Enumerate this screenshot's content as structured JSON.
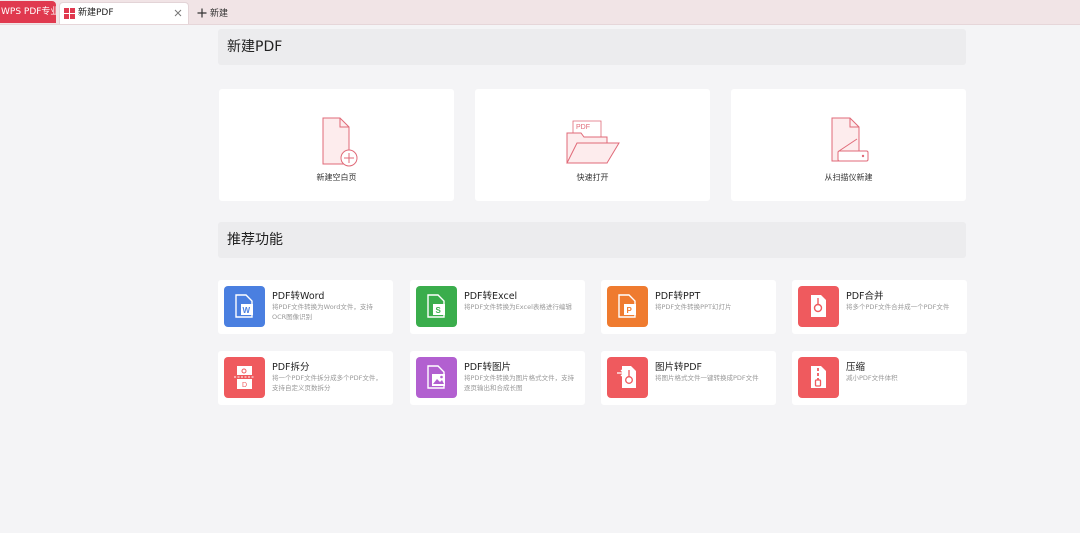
{
  "tabbar": {
    "brand_label": "WPS PDF专业版",
    "doc_tab_label": "新建PDF",
    "new_tab_label": "新建"
  },
  "sections": {
    "new_pdf_title": "新建PDF",
    "recommended_title": "推荐功能"
  },
  "create_cards": [
    {
      "label": "新建空白页",
      "icon": "new-blank-page-icon"
    },
    {
      "label": "快速打开",
      "icon": "quick-open-folder-icon"
    },
    {
      "label": "从扫描仪新建",
      "icon": "scanner-icon"
    }
  ],
  "create_open_icon_text": "PDF",
  "features": [
    {
      "title": "PDF转Word",
      "desc": "将PDF文件转换为Word文件，支持OCR图像识别",
      "color": "#4a7fe0",
      "icon": "pdf-to-word-icon"
    },
    {
      "title": "PDF转Excel",
      "desc": "将PDF文件转换为Excel表格进行编辑",
      "color": "#3aad4c",
      "icon": "pdf-to-excel-icon"
    },
    {
      "title": "PDF转PPT",
      "desc": "将PDF文件转换PPT幻灯片",
      "color": "#ef7b2f",
      "icon": "pdf-to-ppt-icon"
    },
    {
      "title": "PDF合并",
      "desc": "将多个PDF文件合并成一个PDF文件",
      "color": "#ef5a5e",
      "icon": "pdf-merge-icon"
    },
    {
      "title": "PDF拆分",
      "desc": "将一个PDF文件拆分成多个PDF文件，支持自定义页数拆分",
      "color": "#ef5a5e",
      "icon": "pdf-split-icon"
    },
    {
      "title": "PDF转图片",
      "desc": "将PDF文件转换为图片格式文件，支持逐页输出和合成长图",
      "color": "#b260d0",
      "icon": "pdf-to-image-icon"
    },
    {
      "title": "图片转PDF",
      "desc": "将图片格式文件一键转换成PDF文件",
      "color": "#ef5a5e",
      "icon": "image-to-pdf-icon"
    },
    {
      "title": "压缩",
      "desc": "减小PDF文件体积",
      "color": "#ef5a5e",
      "icon": "compress-icon"
    }
  ],
  "colors": {
    "brand": "#e0394f",
    "tabbar_bg": "#f1e4e6",
    "page_bg": "#f4f4f6",
    "icon_line": "#e06a78",
    "icon_fill": "#fdeced"
  }
}
